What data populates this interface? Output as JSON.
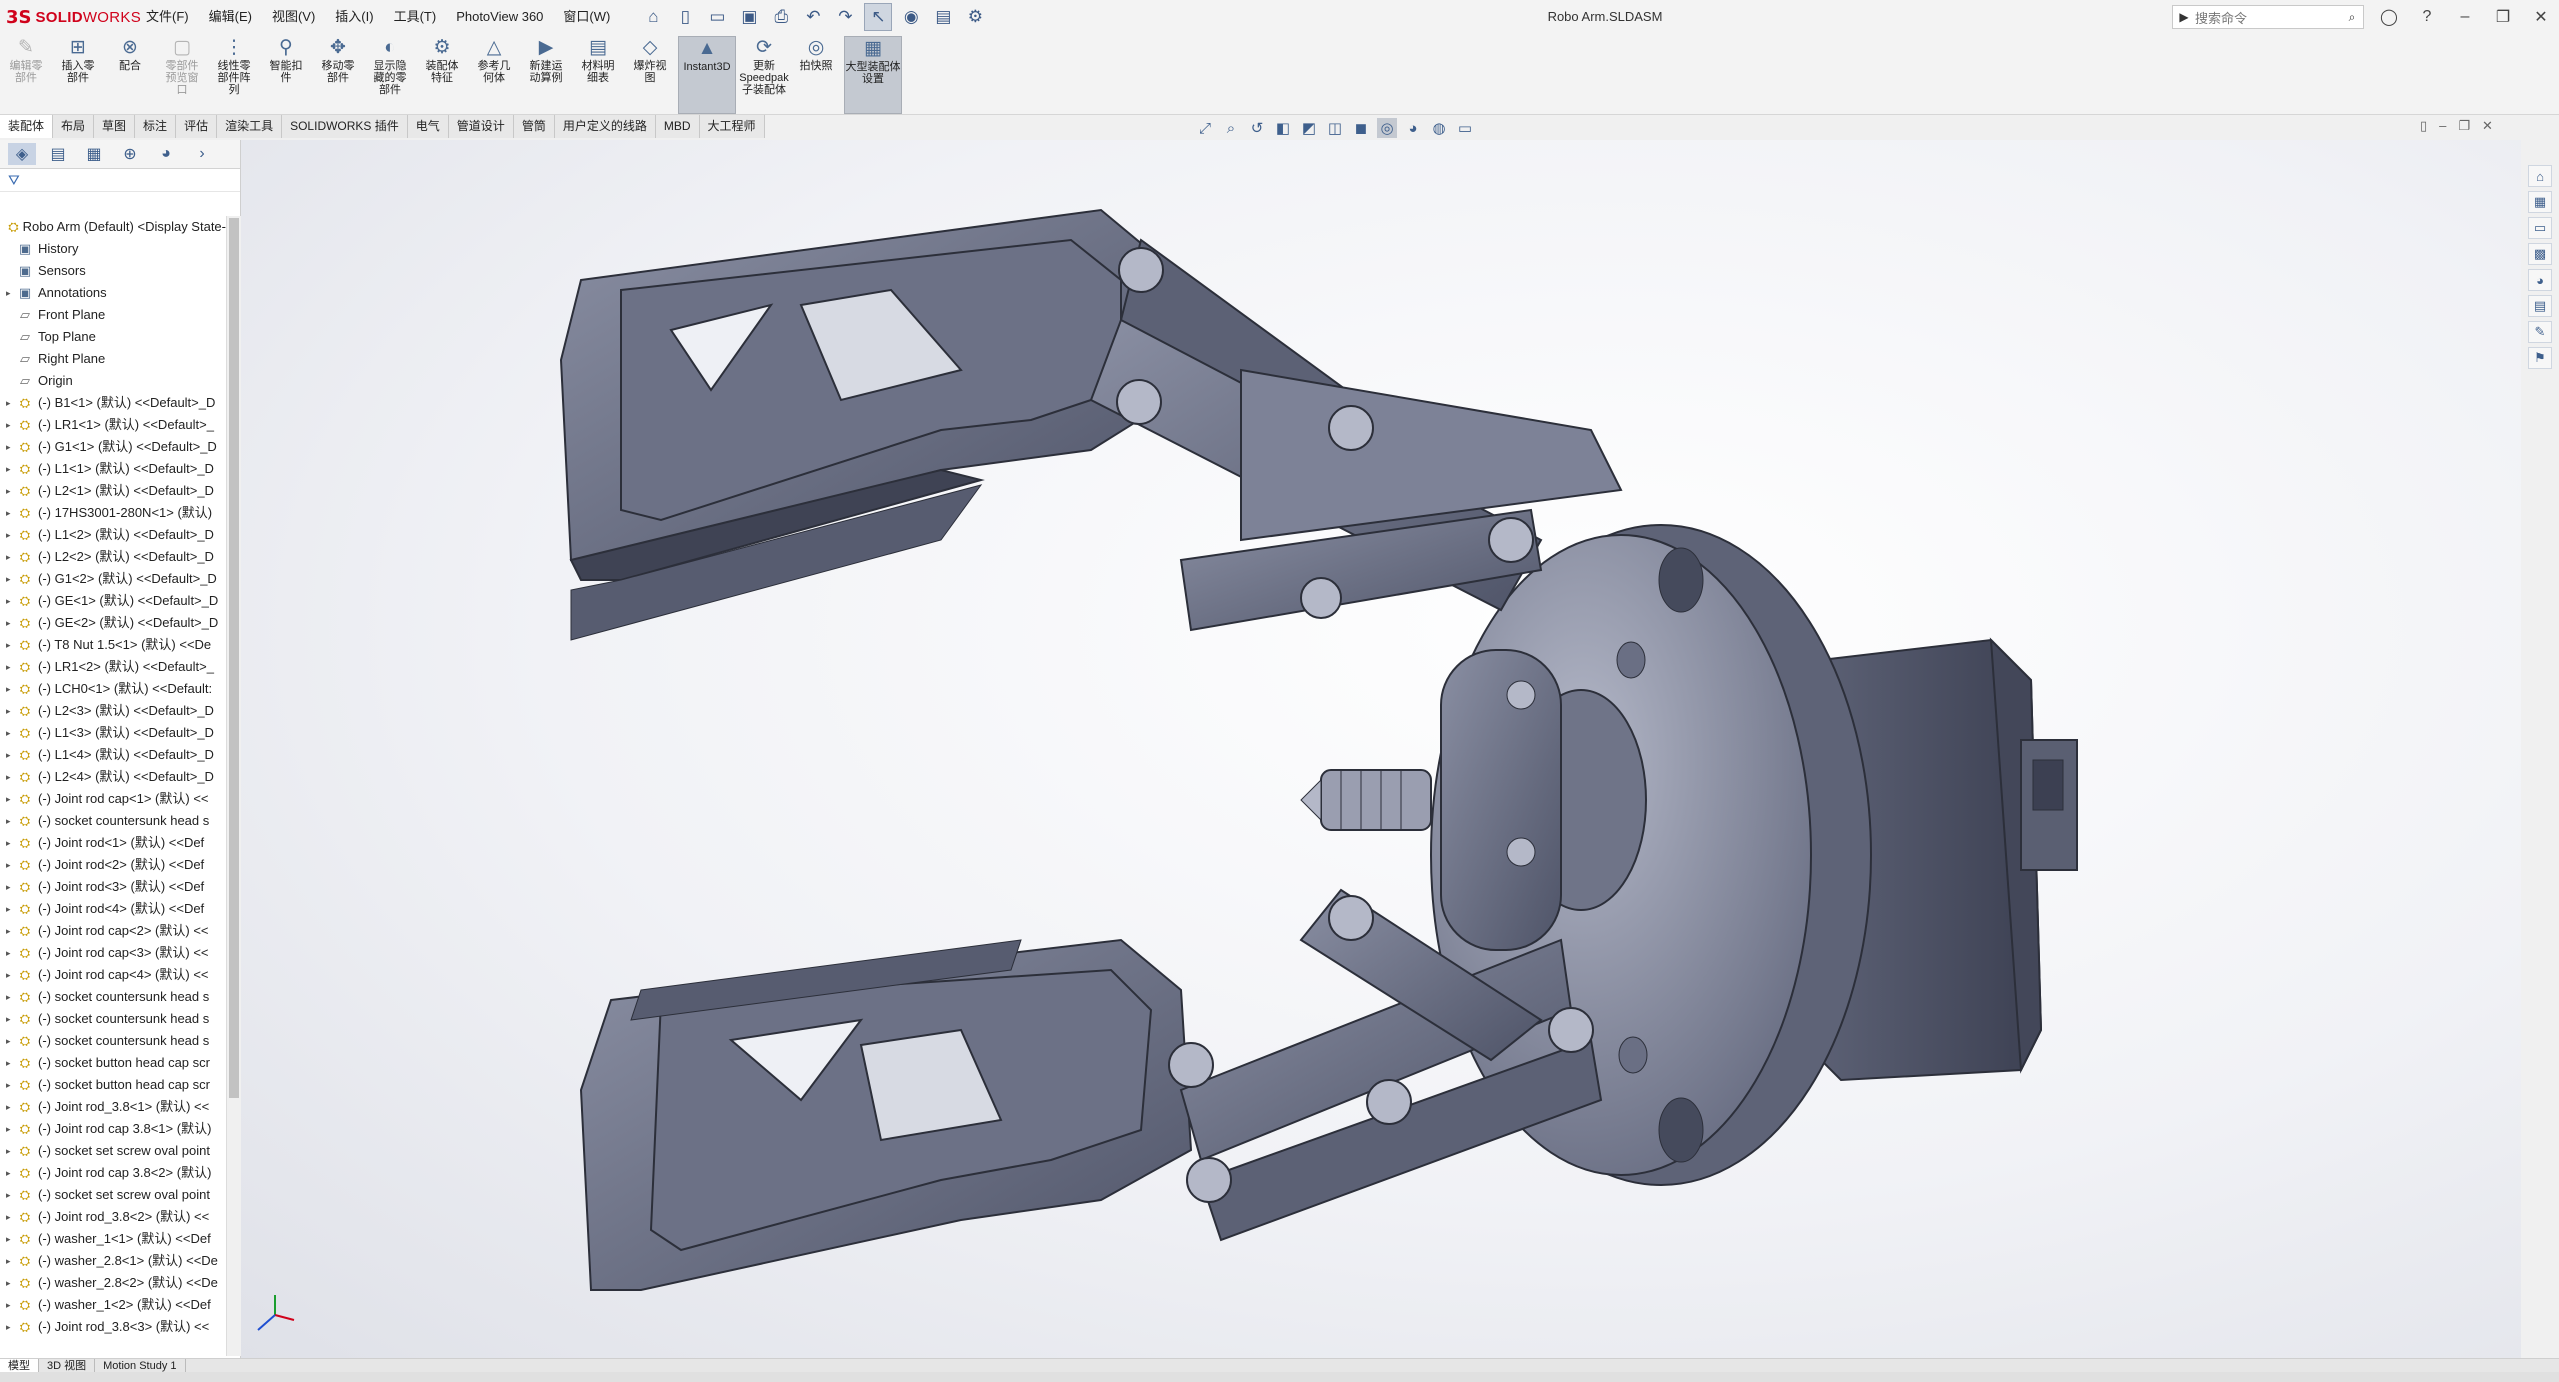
{
  "app": {
    "logo_mark": "3S",
    "logo_bold": "SOLID",
    "logo_light": "WORKS",
    "doc_title": "Robo Arm.SLDASM"
  },
  "menus": [
    "文件(F)",
    "编辑(E)",
    "视图(V)",
    "插入(I)",
    "工具(T)",
    "PhotoView 360",
    "窗口(W)"
  ],
  "search": {
    "placeholder": "搜索命令"
  },
  "window_controls": {
    "minimize": "–",
    "restore": "❐",
    "close": "✕"
  },
  "ribbon": [
    {
      "label": "编辑零部件",
      "dim": true
    },
    {
      "label": "插入零部件",
      "dim": false
    },
    {
      "label": "配合",
      "dim": false
    },
    {
      "label": "零部件预览窗口",
      "dim": true
    },
    {
      "label": "线性零部件阵列",
      "dim": false
    },
    {
      "label": "智能扣件",
      "dim": false
    },
    {
      "label": "移动零部件",
      "dim": false
    },
    {
      "label": "显示隐藏的零部件",
      "dim": false
    },
    {
      "label": "装配体特征",
      "dim": false
    },
    {
      "label": "参考几何体",
      "dim": false
    },
    {
      "label": "新建运动算例",
      "dim": false
    },
    {
      "label": "材料明细表",
      "dim": false
    },
    {
      "label": "爆炸视图",
      "dim": false
    },
    {
      "label": "Instant3D",
      "dim": false,
      "on": true
    },
    {
      "label": "更新Speedpak子装配体",
      "dim": false
    },
    {
      "label": "拍快照",
      "dim": false
    },
    {
      "label": "大型装配体设置",
      "dim": false,
      "on": true
    }
  ],
  "tabs": [
    "装配体",
    "布局",
    "草图",
    "标注",
    "评估",
    "渲染工具",
    "SOLIDWORKS 插件",
    "电气",
    "管道设计",
    "管筒",
    "用户定义的线路",
    "MBD",
    "大工程师"
  ],
  "active_tab": 0,
  "tree": [
    {
      "label": "Robo Arm (Default) <Display State-",
      "icon": "root",
      "arrow": false
    },
    {
      "label": "History",
      "icon": "feat",
      "arrow": false
    },
    {
      "label": "Sensors",
      "icon": "feat",
      "arrow": false
    },
    {
      "label": "Annotations",
      "icon": "feat",
      "arrow": true
    },
    {
      "label": "Front Plane",
      "icon": "plane",
      "arrow": false
    },
    {
      "label": "Top Plane",
      "icon": "plane",
      "arrow": false
    },
    {
      "label": "Right Plane",
      "icon": "plane",
      "arrow": false
    },
    {
      "label": "Origin",
      "icon": "plane",
      "arrow": false
    },
    {
      "label": "(-) B1<1> (默认) <<Default>_D",
      "icon": "comp",
      "arrow": true
    },
    {
      "label": "(-) LR1<1> (默认) <<Default>_",
      "icon": "comp",
      "arrow": true
    },
    {
      "label": "(-) G1<1> (默认) <<Default>_D",
      "icon": "comp",
      "arrow": true
    },
    {
      "label": "(-) L1<1> (默认) <<Default>_D",
      "icon": "comp",
      "arrow": true
    },
    {
      "label": "(-) L2<1> (默认) <<Default>_D",
      "icon": "comp",
      "arrow": true
    },
    {
      "label": "(-) 17HS3001-280N<1> (默认)",
      "icon": "comp",
      "arrow": true
    },
    {
      "label": "(-) L1<2> (默认) <<Default>_D",
      "icon": "comp",
      "arrow": true
    },
    {
      "label": "(-) L2<2> (默认) <<Default>_D",
      "icon": "comp",
      "arrow": true
    },
    {
      "label": "(-) G1<2> (默认) <<Default>_D",
      "icon": "comp",
      "arrow": true
    },
    {
      "label": "(-) GE<1> (默认) <<Default>_D",
      "icon": "comp",
      "arrow": true
    },
    {
      "label": "(-) GE<2> (默认) <<Default>_D",
      "icon": "comp",
      "arrow": true
    },
    {
      "label": "(-) T8 Nut 1.5<1> (默认) <<De",
      "icon": "comp",
      "arrow": true
    },
    {
      "label": "(-) LR1<2> (默认) <<Default>_",
      "icon": "comp",
      "arrow": true
    },
    {
      "label": "(-) LCH0<1> (默认) <<Default:",
      "icon": "comp",
      "arrow": true
    },
    {
      "label": "(-) L2<3> (默认) <<Default>_D",
      "icon": "comp",
      "arrow": true
    },
    {
      "label": "(-) L1<3> (默认) <<Default>_D",
      "icon": "comp",
      "arrow": true
    },
    {
      "label": "(-) L1<4> (默认) <<Default>_D",
      "icon": "comp",
      "arrow": true
    },
    {
      "label": "(-) L2<4> (默认) <<Default>_D",
      "icon": "comp",
      "arrow": true
    },
    {
      "label": "(-) Joint rod cap<1> (默认) <<",
      "icon": "comp",
      "arrow": true
    },
    {
      "label": "(-) socket countersunk head s",
      "icon": "comp",
      "arrow": true
    },
    {
      "label": "(-) Joint rod<1> (默认) <<Def",
      "icon": "comp",
      "arrow": true
    },
    {
      "label": "(-) Joint rod<2> (默认) <<Def",
      "icon": "comp",
      "arrow": true
    },
    {
      "label": "(-) Joint rod<3> (默认) <<Def",
      "icon": "comp",
      "arrow": true
    },
    {
      "label": "(-) Joint rod<4> (默认) <<Def",
      "icon": "comp",
      "arrow": true
    },
    {
      "label": "(-) Joint rod cap<2> (默认) <<",
      "icon": "comp",
      "arrow": true
    },
    {
      "label": "(-) Joint rod cap<3> (默认) <<",
      "icon": "comp",
      "arrow": true
    },
    {
      "label": "(-) Joint rod cap<4> (默认) <<",
      "icon": "comp",
      "arrow": true
    },
    {
      "label": "(-) socket countersunk head s",
      "icon": "comp",
      "arrow": true
    },
    {
      "label": "(-) socket countersunk head s",
      "icon": "comp",
      "arrow": true
    },
    {
      "label": "(-) socket countersunk head s",
      "icon": "comp",
      "arrow": true
    },
    {
      "label": "(-) socket button head cap scr",
      "icon": "comp",
      "arrow": true
    },
    {
      "label": "(-) socket button head cap scr",
      "icon": "comp",
      "arrow": true
    },
    {
      "label": "(-) Joint rod_3.8<1> (默认) <<",
      "icon": "comp",
      "arrow": true
    },
    {
      "label": "(-) Joint rod cap 3.8<1> (默认)",
      "icon": "comp",
      "arrow": true
    },
    {
      "label": "(-) socket set screw oval point",
      "icon": "comp",
      "arrow": true
    },
    {
      "label": "(-) Joint rod cap 3.8<2> (默认)",
      "icon": "comp",
      "arrow": true
    },
    {
      "label": "(-) socket set screw oval point",
      "icon": "comp",
      "arrow": true
    },
    {
      "label": "(-) Joint rod_3.8<2> (默认) <<",
      "icon": "comp",
      "arrow": true
    },
    {
      "label": "(-) washer_1<1> (默认) <<Def",
      "icon": "comp",
      "arrow": true
    },
    {
      "label": "(-) washer_2.8<1> (默认) <<De",
      "icon": "comp",
      "arrow": true
    },
    {
      "label": "(-) washer_2.8<2> (默认) <<De",
      "icon": "comp",
      "arrow": true
    },
    {
      "label": "(-) washer_1<2> (默认) <<Def",
      "icon": "comp",
      "arrow": true
    },
    {
      "label": "(-) Joint rod_3.8<3> (默认) <<",
      "icon": "comp",
      "arrow": true
    }
  ],
  "bottom_tabs": [
    "模型",
    "3D 视图",
    "Motion Study 1"
  ],
  "active_bottom_tab": 0
}
